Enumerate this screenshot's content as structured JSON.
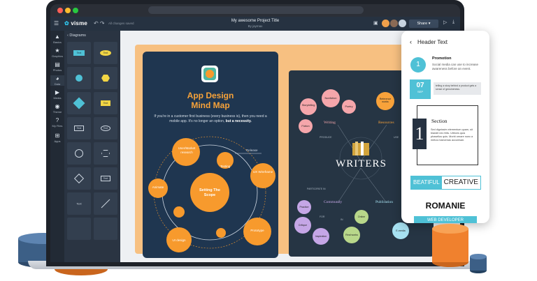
{
  "app": {
    "brand": "visme",
    "saved_status": "All changes saved",
    "project_title": "My awesome Project Title",
    "project_author": "By jaymax",
    "share_label": "Share"
  },
  "left_rail": {
    "items": [
      {
        "label": "Basics",
        "icon": "shapes-icon"
      },
      {
        "label": "Graphics",
        "icon": "star-icon"
      },
      {
        "label": "Photos",
        "icon": "image-icon"
      },
      {
        "label": "Data",
        "icon": "pie-icon"
      },
      {
        "label": "Media",
        "icon": "play-icon"
      },
      {
        "label": "Theme",
        "icon": "palette-icon"
      },
      {
        "label": "My Files",
        "icon": "question-icon"
      },
      {
        "label": "Apps",
        "icon": "grid-icon"
      }
    ]
  },
  "panel": {
    "back_label": "Diagrams",
    "tile_label": "Text"
  },
  "mindmap": {
    "title_line1": "App Design",
    "title_line2": "Mind Map",
    "body": "If you're in a customer first business (every business is), then you need a mobile app. It's no longer an option,",
    "body_bold": "but a necessity.",
    "center": "Setting The Scope",
    "nodes": {
      "research": "User/Market research",
      "testing": "Testing",
      "release": "Release",
      "wireframe": "UX Wireframe",
      "animate": "Animate",
      "prototype": "Prototype",
      "ui_design": "UI design"
    }
  },
  "writers": {
    "title": "WRITERS",
    "branches": {
      "writing": "Writing",
      "resources": "Resources",
      "community": "Community",
      "publication": "Publication"
    },
    "small_labels": {
      "produce": "PRODUCE",
      "use": "USE",
      "participate": "PARTICIPATE IN",
      "for": "FOR",
      "in": "IN"
    },
    "nodes": {
      "storytelling": "Storytelling",
      "nonfiction": "Nonfiction",
      "poetry": "Poetry",
      "fiction": "Fiction",
      "reference": "Reference works",
      "practice": "Practice",
      "critique": "Critique",
      "inspiration": "Inspiration",
      "online": "Online",
      "real_works": "Real works",
      "email": "E-media"
    }
  },
  "phone": {
    "header": "Header Text",
    "promo_title": "Promotion",
    "promo_body": "Social media can use to increase awareness before an event.",
    "promo_num": "1",
    "date_day": "07",
    "date_month": "SEP",
    "date_text": "telling a story behind a product gets a sense of genuineness.",
    "section_num": "1",
    "section_title": "Section",
    "section_body": "Sed dignissim elementum quam, sit blandit nec felis. Ultrices quia phasellus quis. Morbi ornare nunc a metus maecenas accumsan.",
    "beat_a": "BEATIFUL",
    "beat_b": "CREATIVE",
    "romanie": "ROMANIE",
    "webdev": "WEB DEVELOPER"
  },
  "colors": {
    "accent_orange": "#f79a2d",
    "dark_navy": "#1f3650",
    "teal": "#4fc1d6",
    "prop_blue": "#3c5f86"
  }
}
